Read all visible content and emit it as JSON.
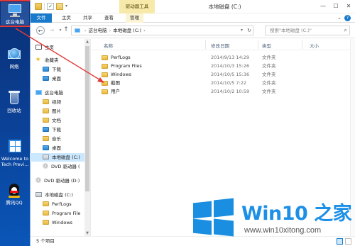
{
  "desktop": {
    "icons": [
      {
        "label": "这台电脑",
        "name": "this-pc"
      },
      {
        "label": "网络",
        "name": "network"
      },
      {
        "label": "回收站",
        "name": "recycle-bin"
      },
      {
        "label": "Welcome to Tech Previ...",
        "name": "welcome"
      },
      {
        "label": "腾讯QQ",
        "name": "qq"
      }
    ]
  },
  "window": {
    "title": "本地磁盘 (C:)",
    "contextual_tab": "驱动器工具",
    "controls": {
      "minimize": "—",
      "maximize": "☐",
      "close": "✕"
    }
  },
  "ribbon": {
    "tabs": [
      "文件",
      "主页",
      "共享",
      "查看",
      "管理"
    ]
  },
  "address": {
    "segments": [
      "这台电脑",
      "本地磁盘 (C:)"
    ],
    "search_placeholder": "搜索\"本地磁盘 (C:)\""
  },
  "nav_pane": {
    "items": [
      {
        "label": "主页",
        "icon": "home-icon",
        "indent": 0
      },
      {
        "label": "收藏夹",
        "icon": "star-icon",
        "indent": 0
      },
      {
        "label": "下载",
        "icon": "download-folder-icon",
        "indent": 1
      },
      {
        "label": "桌面",
        "icon": "desktop-folder-icon",
        "indent": 1
      },
      {
        "label": "这台电脑",
        "icon": "pc-icon",
        "indent": 0
      },
      {
        "label": "视频",
        "icon": "videos-folder-icon",
        "indent": 1
      },
      {
        "label": "图片",
        "icon": "pictures-folder-icon",
        "indent": 1
      },
      {
        "label": "文档",
        "icon": "documents-folder-icon",
        "indent": 1
      },
      {
        "label": "下载",
        "icon": "download-folder-icon",
        "indent": 1
      },
      {
        "label": "音乐",
        "icon": "music-folder-icon",
        "indent": 1
      },
      {
        "label": "桌面",
        "icon": "desktop-folder-icon",
        "indent": 1
      },
      {
        "label": "本地磁盘 (C:)",
        "icon": "drive-icon",
        "indent": 1,
        "selected": true
      },
      {
        "label": "DVD 驱动器 (",
        "icon": "dvd-icon",
        "indent": 1
      },
      {
        "label": "DVD 驱动器 (D:)",
        "icon": "dvd-icon",
        "indent": 0
      },
      {
        "label": "本地磁盘 (C:)",
        "icon": "drive-icon",
        "indent": 0
      },
      {
        "label": "PerfLogs",
        "icon": "folder-icon",
        "indent": 1
      },
      {
        "label": "Program File",
        "icon": "folder-icon",
        "indent": 1
      },
      {
        "label": "Windows",
        "icon": "folder-icon",
        "indent": 1
      }
    ]
  },
  "file_list": {
    "columns": [
      "名称",
      "修改日期",
      "类型",
      "大小"
    ],
    "rows": [
      {
        "name": "PerfLogs",
        "date": "2014/9/13 14:29",
        "type": "文件夹"
      },
      {
        "name": "Program Files",
        "date": "2014/10/3 15:26",
        "type": "文件夹"
      },
      {
        "name": "Windows",
        "date": "2014/10/5 15:36",
        "type": "文件夹"
      },
      {
        "name": "截图",
        "date": "2014/10/5 7:22",
        "type": "文件夹"
      },
      {
        "name": "用户",
        "date": "2014/10/2 10:59",
        "type": "文件夹"
      }
    ]
  },
  "status": {
    "count": "5 个项目"
  },
  "watermark": {
    "title": "Win10 之家",
    "url": "www.win10xitong.com"
  },
  "colors": {
    "accent": "#1979ca",
    "selection": "#cce8ff",
    "annotation": "#e23b3b",
    "watermark": "#1c8fe6"
  }
}
